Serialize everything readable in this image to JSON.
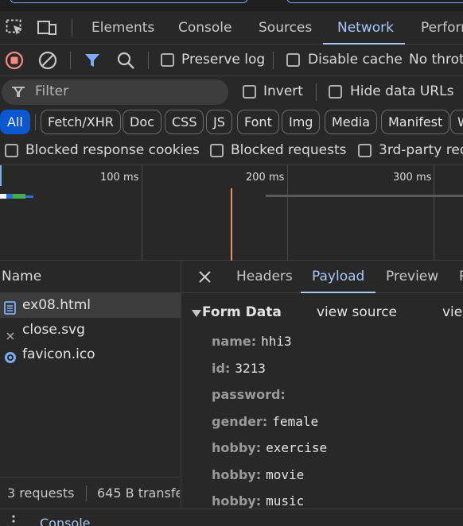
{
  "tabs": [
    "Elements",
    "Console",
    "Sources",
    "Network",
    "Perform"
  ],
  "active_tab": "Network",
  "toolbar": {
    "preserve_log": "Preserve log",
    "disable_cache": "Disable cache",
    "throttle": "No throt"
  },
  "filter": {
    "placeholder": "Filter",
    "invert": "Invert",
    "hide_data_urls": "Hide data URLs"
  },
  "type_filters": [
    "All",
    "Fetch/XHR",
    "Doc",
    "CSS",
    "JS",
    "Font",
    "Img",
    "Media",
    "Manifest",
    "W"
  ],
  "blocked": {
    "cookies": "Blocked response cookies",
    "requests": "Blocked requests",
    "third_party": "3rd-party req"
  },
  "timeline_ticks": [
    "100 ms",
    "200 ms",
    "300 ms"
  ],
  "requests": {
    "header": "Name",
    "items": [
      {
        "name": "ex08.html",
        "icon": "document-icon"
      },
      {
        "name": "close.svg",
        "icon": "close-icon"
      },
      {
        "name": "favicon.ico",
        "icon": "favicon-icon"
      }
    ]
  },
  "detail_tabs": [
    "Headers",
    "Payload",
    "Preview",
    "R"
  ],
  "active_detail_tab": "Payload",
  "form_data": {
    "title": "Form Data",
    "view_source": "view source",
    "view_decoded": "view",
    "fields": [
      {
        "key": "name:",
        "value": "hhi3"
      },
      {
        "key": "id:",
        "value": "3213"
      },
      {
        "key": "password:",
        "value": ""
      },
      {
        "key": "gender:",
        "value": "female"
      },
      {
        "key": "hobby:",
        "value": "exercise"
      },
      {
        "key": "hobby:",
        "value": "movie"
      },
      {
        "key": "hobby:",
        "value": "music"
      }
    ]
  },
  "status": {
    "requests": "3 requests",
    "transferred": "645 B transfe"
  },
  "drawer": {
    "console": "Console"
  },
  "colors": {
    "accent": "#a8c7fa",
    "record_red": "#f28b82",
    "active_chip": "#0b57d0"
  }
}
